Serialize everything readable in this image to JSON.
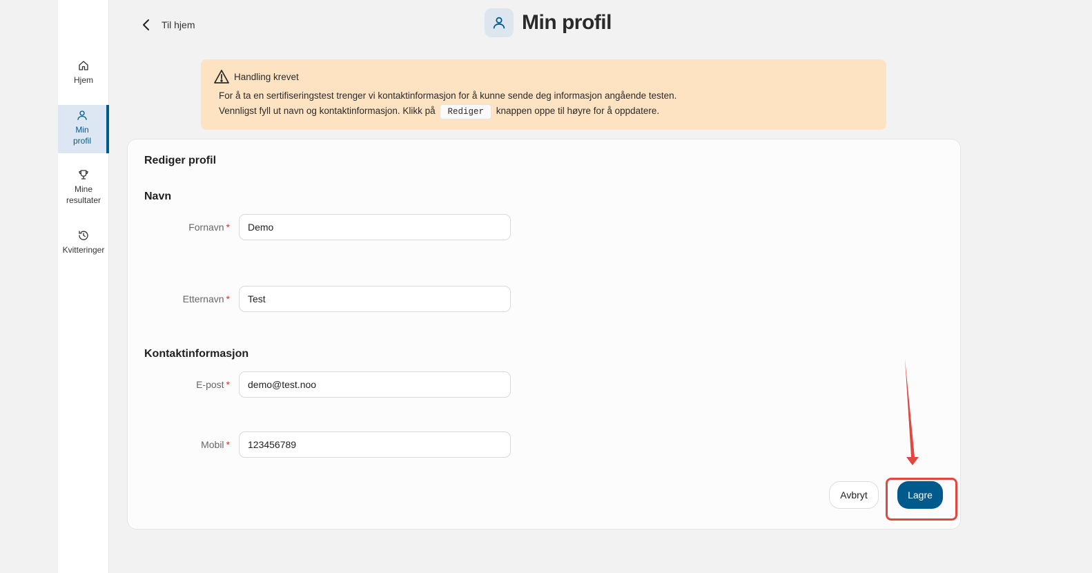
{
  "sidebar": {
    "items": [
      {
        "label": "Hjem",
        "icon": "home-icon"
      },
      {
        "label": "Min profil",
        "icon": "user-icon",
        "active": true
      },
      {
        "label": "Mine resultater",
        "icon": "trophy-icon"
      },
      {
        "label": "Kvitteringer",
        "icon": "history-icon"
      }
    ]
  },
  "header": {
    "back_label": "Til hjem",
    "title": "Min profil"
  },
  "alert": {
    "title": "Handling krevet",
    "line1": "For å ta en sertifiseringstest trenger vi kontaktinformasjon for å kunne sende deg informasjon angående testen.",
    "line2_before": "Vennligst fyll ut navn og kontaktinformasjon. Klikk på",
    "code": "Rediger",
    "line2_after": "knappen oppe til høyre for å oppdatere."
  },
  "form": {
    "title": "Rediger profil",
    "section_name": "Navn",
    "section_contact": "Kontaktinformasjon",
    "required_marker": "*",
    "fields": {
      "first_name": {
        "label": "Fornavn",
        "value": "Demo"
      },
      "last_name": {
        "label": "Etternavn",
        "value": "Test"
      },
      "email": {
        "label": "E-post",
        "value": "demo@test.noo"
      },
      "mobile": {
        "label": "Mobil",
        "value": "123456789"
      }
    },
    "cancel_label": "Avbryt",
    "save_label": "Lagre"
  },
  "colors": {
    "accent": "#005a8c",
    "alert_bg": "#fde3c2",
    "highlight": "#e0483f"
  }
}
